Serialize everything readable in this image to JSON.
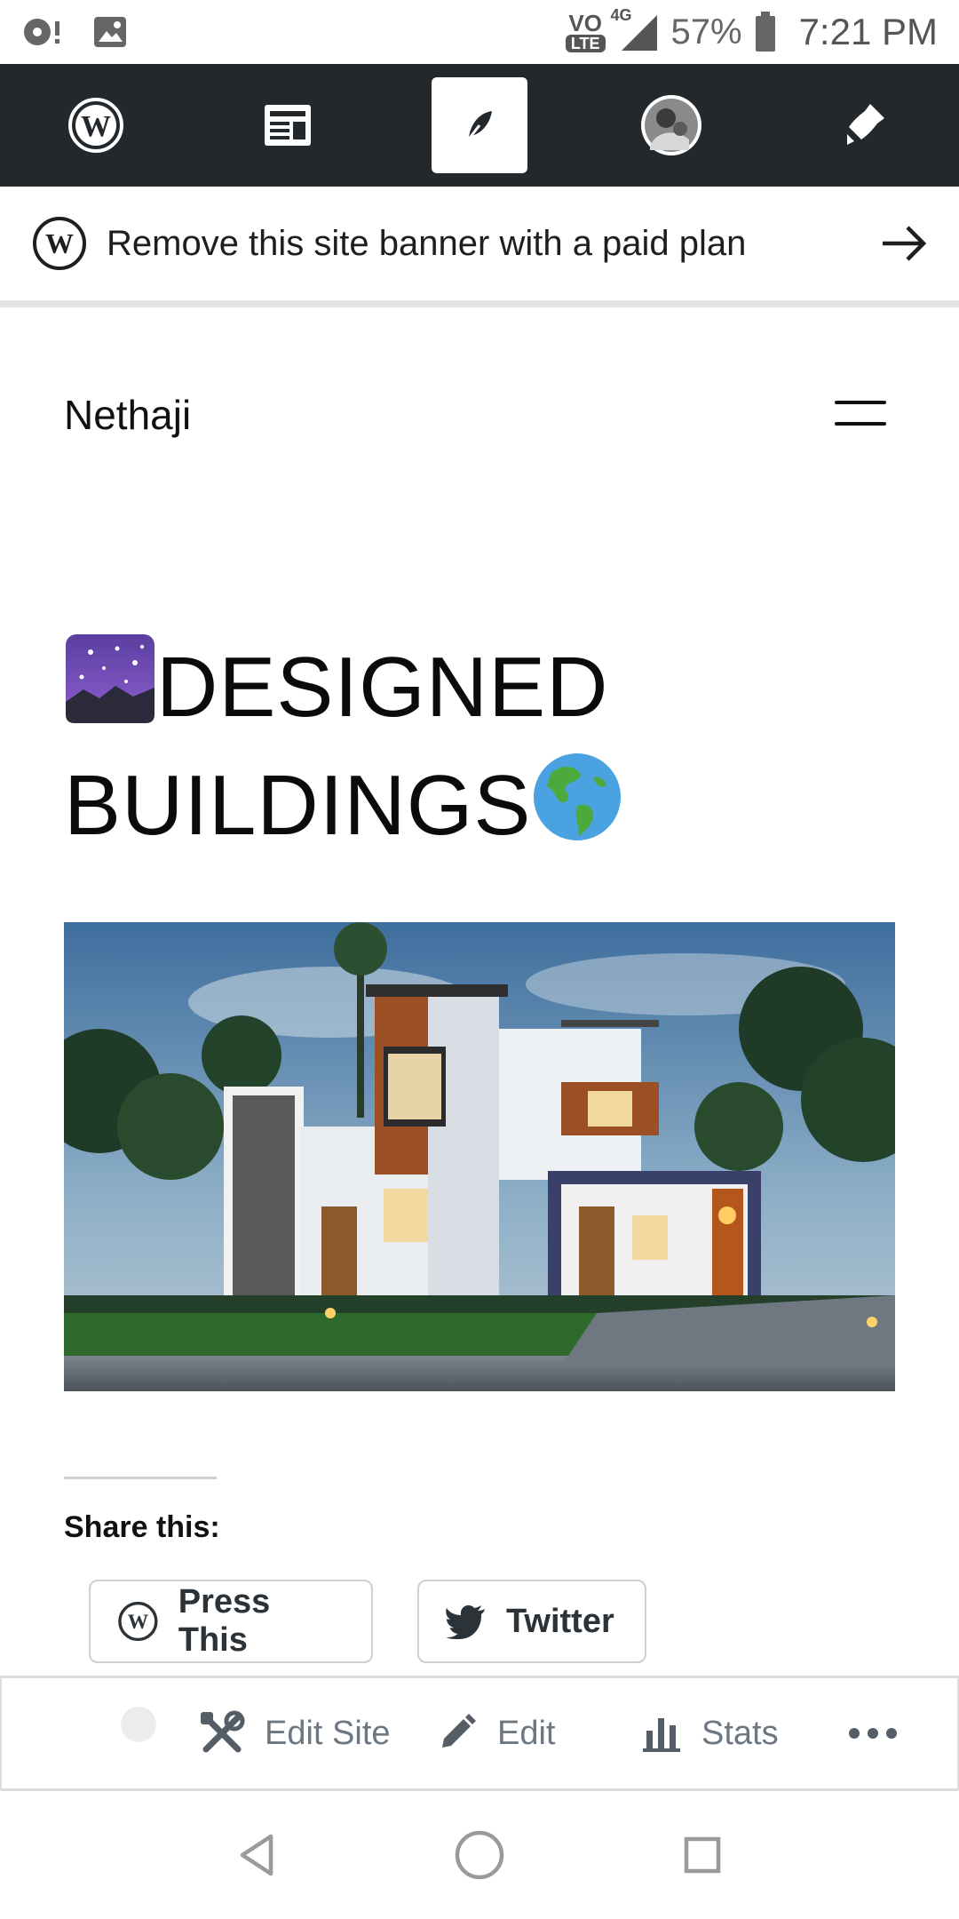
{
  "status_bar": {
    "network_badge": "VO",
    "lte_label": "LTE",
    "network_type": "4G",
    "battery": "57%",
    "time": "7:21 PM"
  },
  "admin_bar": {
    "items": [
      "wordpress-logo-icon",
      "reader-icon",
      "write-feather-icon",
      "avatar",
      "notifications-bell-icon"
    ],
    "active_index": 2
  },
  "banner": {
    "text": "Remove this site banner with a paid plan"
  },
  "site": {
    "title": "Nethaji"
  },
  "post": {
    "title_line1": "DESIGNED",
    "title_line2": "BUILDINGS"
  },
  "share": {
    "heading": "Share this:",
    "press_this": "Press This",
    "twitter": "Twitter"
  },
  "edit_bar": {
    "edit_site": "Edit Site",
    "edit": "Edit",
    "stats": "Stats"
  },
  "colors": {
    "admin_bar_bg": "#23282d",
    "text": "#1e1e1e",
    "muted": "#6c7781"
  }
}
